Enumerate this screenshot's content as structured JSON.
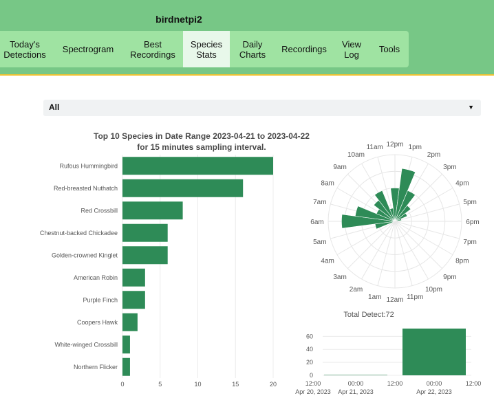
{
  "app": {
    "title": "birdnetpi2"
  },
  "nav": {
    "items": [
      {
        "label": "Today's\nDetections",
        "active": false
      },
      {
        "label": "Spectrogram",
        "active": false
      },
      {
        "label": "Best\nRecordings",
        "active": false
      },
      {
        "label": "Species\nStats",
        "active": true
      },
      {
        "label": "Daily\nCharts",
        "active": false
      },
      {
        "label": "Recordings",
        "active": false
      },
      {
        "label": "View\nLog",
        "active": false
      },
      {
        "label": "Tools",
        "active": false
      }
    ]
  },
  "filter": {
    "value": "All",
    "icon": "chevron-down-icon"
  },
  "colors": {
    "header": "#77c786",
    "nav": "#9fe3a2",
    "bar": "#2e8b57",
    "accent_line": "#f2c230"
  },
  "chart_data": [
    {
      "type": "bar",
      "orientation": "horizontal",
      "title": "Top 10 Species in Date Range 2023-04-21 to 2023-04-22",
      "subtitle": "for 15 minutes sampling interval.",
      "categories": [
        "Rufous Hummingbird",
        "Red-breasted Nuthatch",
        "Red Crossbill",
        "Chestnut-backed Chickadee",
        "Golden-crowned Kinglet",
        "American Robin",
        "Purple Finch",
        "Coopers Hawk",
        "White-winged Crossbill",
        "Northern Flicker"
      ],
      "values": [
        20,
        16,
        8,
        6,
        6,
        3,
        3,
        2,
        1,
        1
      ],
      "xlim": [
        0,
        20
      ],
      "xticks": [
        "0",
        "5",
        "10",
        "15",
        "20"
      ]
    },
    {
      "type": "polar-bar",
      "labels": [
        "12am",
        "1am",
        "2am",
        "3am",
        "4am",
        "5am",
        "6am",
        "7am",
        "8am",
        "9am",
        "10am",
        "11am",
        "12pm",
        "1pm",
        "2pm",
        "3pm",
        "4pm",
        "5pm",
        "6pm",
        "7pm",
        "8pm",
        "9pm",
        "10pm",
        "11pm"
      ],
      "values": [
        0,
        0,
        0,
        0,
        0,
        0.3,
        0.8,
        0.6,
        0.3,
        0.4,
        0.5,
        0.2,
        0.5,
        0.8,
        0.5,
        0.3,
        0.2,
        0.1,
        0,
        0,
        0,
        0,
        0,
        0
      ]
    },
    {
      "type": "bar",
      "title": "Total Detect:72",
      "x": [
        "Apr 21, 2023 00:00",
        "Apr 22, 2023 00:00"
      ],
      "values": [
        1,
        72
      ],
      "ylim": [
        0,
        72
      ],
      "yticks": [
        "0",
        "20",
        "40",
        "60"
      ],
      "xticks": [
        {
          "time": "12:00",
          "date": "Apr 20, 2023"
        },
        {
          "time": "00:00",
          "date": "Apr 21, 2023"
        },
        {
          "time": "12:00",
          "date": ""
        },
        {
          "time": "00:00",
          "date": "Apr 22, 2023"
        },
        {
          "time": "12:00",
          "date": ""
        }
      ]
    }
  ]
}
